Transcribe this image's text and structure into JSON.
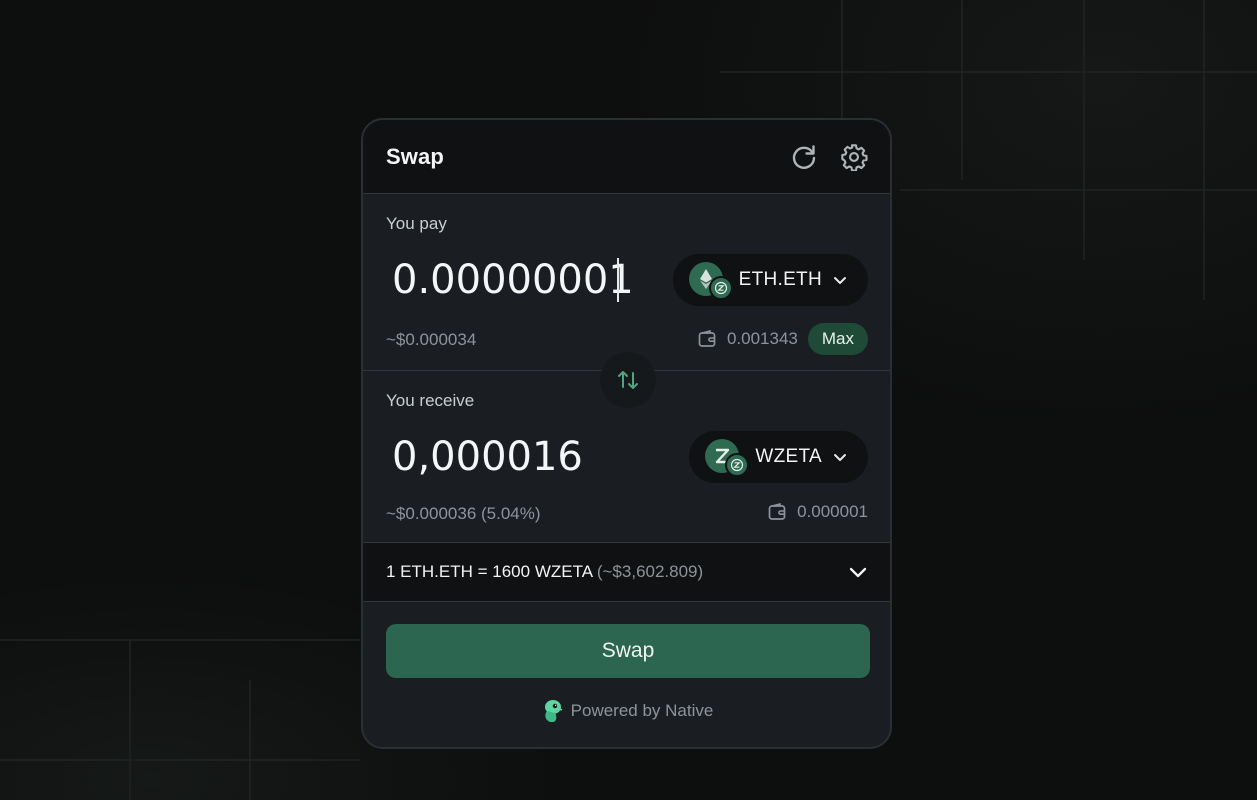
{
  "swap": {
    "title": "Swap",
    "pay": {
      "label": "You pay",
      "amount": "0.00000001",
      "usd": "~$0.000034",
      "token": "ETH.ETH",
      "balance": "0.001343",
      "max_label": "Max"
    },
    "receive": {
      "label": "You receive",
      "amount": "0,000016",
      "usd": "~$0.000036 (5.04%)",
      "token": "WZETA",
      "balance": "0.000001"
    },
    "rate": {
      "text": "1 ETH.ETH = 1600 WZETA",
      "usd": "(~$3,602.809)"
    },
    "button_label": "Swap",
    "powered_by": "Powered by Native"
  },
  "icons": {
    "refresh": "refresh-icon",
    "settings": "gear-icon",
    "wallet": "wallet-icon",
    "chevron": "chevron-down-icon",
    "switch": "arrows-swap-icon"
  },
  "colors": {
    "accent": "#2d6650",
    "background": "#0d0e0e",
    "card": "#1a1e22"
  }
}
